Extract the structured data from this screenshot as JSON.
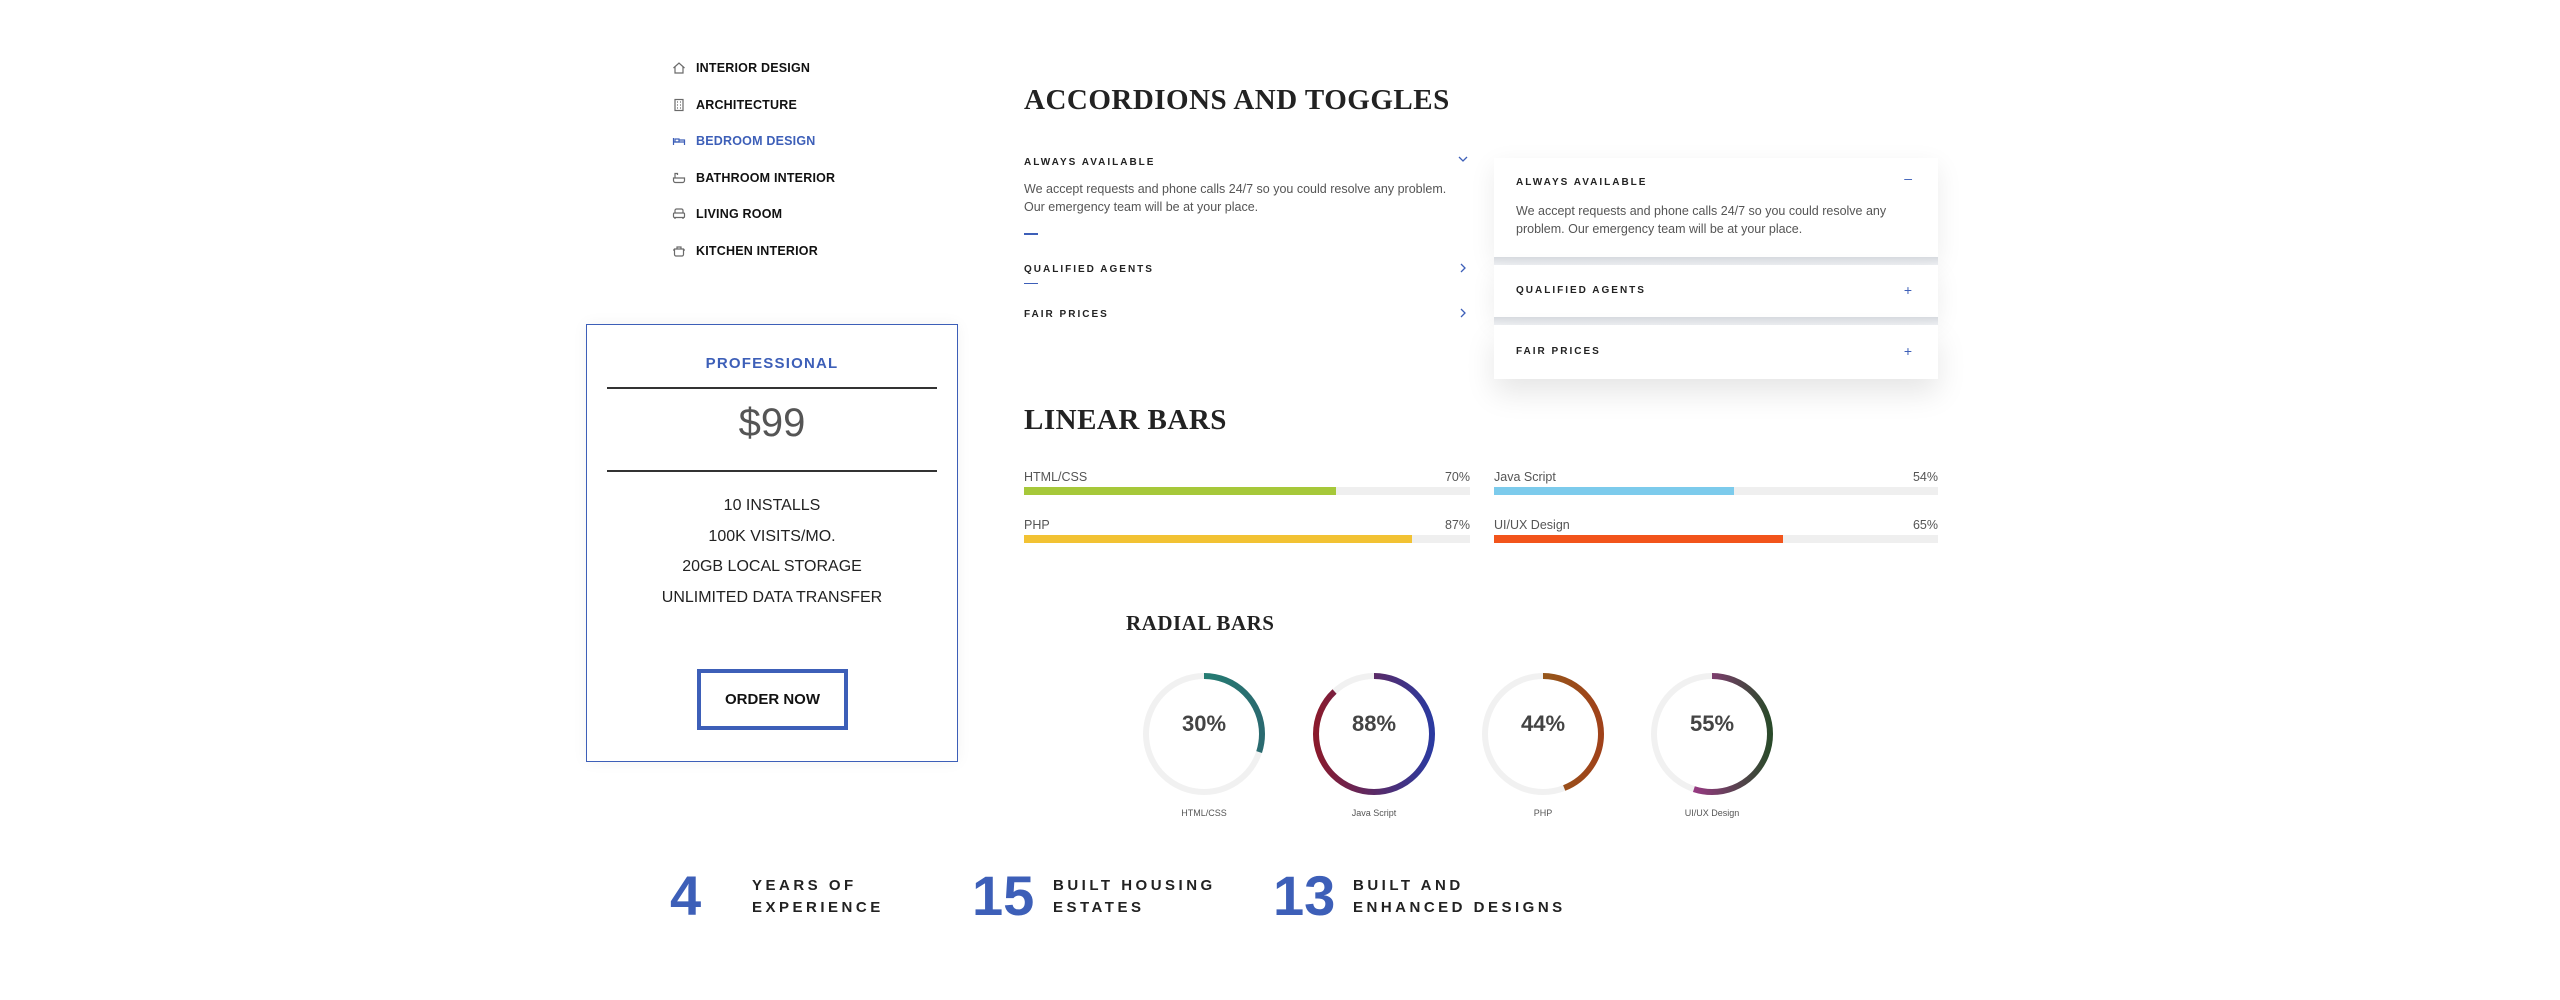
{
  "sidebar": {
    "items": [
      {
        "label": "INTERIOR DESIGN",
        "icon": "home-icon"
      },
      {
        "label": "ARCHITECTURE",
        "icon": "building-icon"
      },
      {
        "label": "BEDROOM DESIGN",
        "icon": "bed-icon"
      },
      {
        "label": "BATHROOM INTERIOR",
        "icon": "bath-icon"
      },
      {
        "label": "LIVING ROOM",
        "icon": "armchair-icon"
      },
      {
        "label": "KITCHEN INTERIOR",
        "icon": "pot-icon"
      }
    ],
    "active_item": "BEDROOM DESIGN"
  },
  "pricing": {
    "plan": "PROFESSIONAL",
    "price": "$99",
    "features": [
      "10 INSTALLS",
      "100K VISITS/MO.",
      "20GB LOCAL STORAGE",
      "UNLIMITED DATA TRANSFER"
    ],
    "order_label": "ORDER NOW"
  },
  "accordions": {
    "heading": "ACCORDIONS AND TOGGLES",
    "left": [
      {
        "title": "ALWAYS AVAILABLE",
        "body": "We accept requests and phone calls 24/7 so you could resolve any problem. Our emergency team will be at your place.",
        "open": true
      },
      {
        "title": "QUALIFIED AGENTS",
        "open": false
      },
      {
        "title": "FAIR PRICES",
        "open": false
      }
    ],
    "right": [
      {
        "title": "ALWAYS AVAILABLE",
        "body": "We accept requests and phone calls 24/7 so you could resolve any problem. Our emergency team will be at your place.",
        "sign": "–"
      },
      {
        "title": "QUALIFIED AGENTS",
        "sign": "+"
      },
      {
        "title": "FAIR PRICES",
        "sign": "+"
      }
    ]
  },
  "linear_bars": {
    "heading": "LINEAR BARS",
    "items": [
      {
        "name": "HTML/CSS",
        "value": 70,
        "label": "70%",
        "color": "#a6c83a"
      },
      {
        "name": "Java Script",
        "value": 54,
        "label": "54%",
        "color": "#7ccbec"
      },
      {
        "name": "PHP",
        "value": 87,
        "label": "87%",
        "color": "#f2c233"
      },
      {
        "name": "UI/UX Design",
        "value": 65,
        "label": "65%",
        "color": "#f2541b"
      }
    ]
  },
  "radial_bars": {
    "heading": "RADIAL BARS",
    "items": [
      {
        "name": "HTML/CSS",
        "value": 30,
        "label": "30%",
        "color_start": "#1f8f74",
        "color_end": "#2a6a70"
      },
      {
        "name": "Java Script",
        "value": 88,
        "label": "88%",
        "color_start": "#8a1a2c",
        "color_end": "#2b3aa0"
      },
      {
        "name": "PHP",
        "value": 44,
        "label": "44%",
        "color_start": "#8a6a1a",
        "color_end": "#a0421a"
      },
      {
        "name": "UI/UX Design",
        "value": 55,
        "label": "55%",
        "color_start": "#d030b0",
        "color_end": "#2a4a2a"
      }
    ]
  },
  "stats": [
    {
      "number": "4",
      "line1": "YEARS OF",
      "line2": "EXPERIENCE"
    },
    {
      "number": "15",
      "line1": "BUILT HOUSING",
      "line2": "ESTATES"
    },
    {
      "number": "13",
      "line1": "BUILT AND",
      "line2": "ENHANCED DESIGNS"
    }
  ],
  "colors": {
    "accent": "#3d5fb8",
    "text": "#222222",
    "muted": "#555555"
  }
}
